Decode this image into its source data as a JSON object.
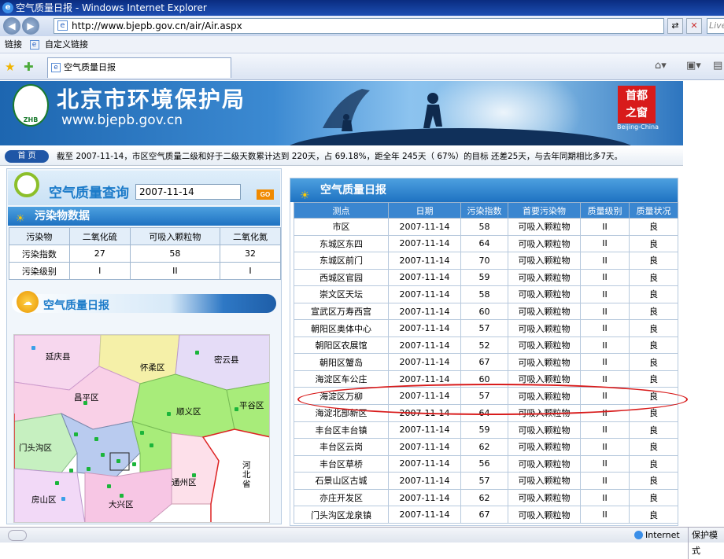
{
  "window": {
    "title": "空气质量日报 - Windows Internet Explorer"
  },
  "address": {
    "url": "http://www.bjepb.gov.cn/air/Air.aspx",
    "search_placeholder": "Live"
  },
  "linksbar": {
    "label": "链接",
    "link1": "自定义链接"
  },
  "tab": {
    "title": "空气质量日报"
  },
  "banner": {
    "org_name": "北京市环境保护局",
    "site_url": "www.bjepb.gov.cn",
    "logo_text": "ZHB",
    "seal_line1": "首都",
    "seal_line2": "之窗",
    "seal_caption": "Beijing-China"
  },
  "ticker": {
    "home_label": "首  页",
    "text": "截至  2007-11-14，市区空气质量二级和好于二级天数累计达到  220天，占  69.18%，距全年  245天（  67%）的目标  还差25天，与去年同期相比多7天。"
  },
  "query": {
    "title": "空气质量查询",
    "date_value": "2007-11-14",
    "go_label": "GO"
  },
  "pollutants": {
    "title": "污染物数据",
    "headers": [
      "污染物",
      "二氧化硫",
      "可吸入颗粒物",
      "二氧化氮"
    ],
    "rows": [
      [
        "污染指数",
        "27",
        "58",
        "32"
      ],
      [
        "污染级别",
        "I",
        "II",
        "I"
      ]
    ]
  },
  "daily_report_left": {
    "title": "空气质量日报"
  },
  "map": {
    "labels": [
      "延庆县",
      "怀柔区",
      "密云县",
      "昌平区",
      "顺义区",
      "平谷区",
      "门头沟区",
      "通州区",
      "房山区",
      "大兴区",
      "河北省"
    ]
  },
  "report": {
    "title": "空气质量日报",
    "headers": [
      "测点",
      "日期",
      "污染指数",
      "首要污染物",
      "质量级别",
      "质量状况"
    ],
    "rows": [
      [
        "市区",
        "2007-11-14",
        "58",
        "可吸入颗粒物",
        "II",
        "良"
      ],
      [
        "东城区东四",
        "2007-11-14",
        "64",
        "可吸入颗粒物",
        "II",
        "良"
      ],
      [
        "东城区前门",
        "2007-11-14",
        "70",
        "可吸入颗粒物",
        "II",
        "良"
      ],
      [
        "西城区官园",
        "2007-11-14",
        "59",
        "可吸入颗粒物",
        "II",
        "良"
      ],
      [
        "崇文区天坛",
        "2007-11-14",
        "58",
        "可吸入颗粒物",
        "II",
        "良"
      ],
      [
        "宣武区万寿西宫",
        "2007-11-14",
        "60",
        "可吸入颗粒物",
        "II",
        "良"
      ],
      [
        "朝阳区奥体中心",
        "2007-11-14",
        "57",
        "可吸入颗粒物",
        "II",
        "良"
      ],
      [
        "朝阳区农展馆",
        "2007-11-14",
        "52",
        "可吸入颗粒物",
        "II",
        "良"
      ],
      [
        "朝阳区蟹岛",
        "2007-11-14",
        "67",
        "可吸入颗粒物",
        "II",
        "良"
      ],
      [
        "海淀区车公庄",
        "2007-11-14",
        "60",
        "可吸入颗粒物",
        "II",
        "良"
      ],
      [
        "海淀区万柳",
        "2007-11-14",
        "57",
        "可吸入颗粒物",
        "II",
        "良"
      ],
      [
        "海淀北部新区",
        "2007-11-14",
        "64",
        "可吸入颗粒物",
        "II",
        "良"
      ],
      [
        "丰台区丰台镇",
        "2007-11-14",
        "59",
        "可吸入颗粒物",
        "II",
        "良"
      ],
      [
        "丰台区云岗",
        "2007-11-14",
        "62",
        "可吸入颗粒物",
        "II",
        "良"
      ],
      [
        "丰台区草桥",
        "2007-11-14",
        "56",
        "可吸入颗粒物",
        "II",
        "良"
      ],
      [
        "石景山区古城",
        "2007-11-14",
        "57",
        "可吸入颗粒物",
        "II",
        "良"
      ],
      [
        "亦庄开发区",
        "2007-11-14",
        "62",
        "可吸入颗粒物",
        "II",
        "良"
      ],
      [
        "门头沟区龙泉镇",
        "2007-11-14",
        "67",
        "可吸入颗粒物",
        "II",
        "良"
      ]
    ]
  },
  "status": {
    "zone": "Internet",
    "protected": "保护模式"
  },
  "colors": {
    "highlight": "#d81b1b",
    "header_blue": "#3a86d0"
  }
}
